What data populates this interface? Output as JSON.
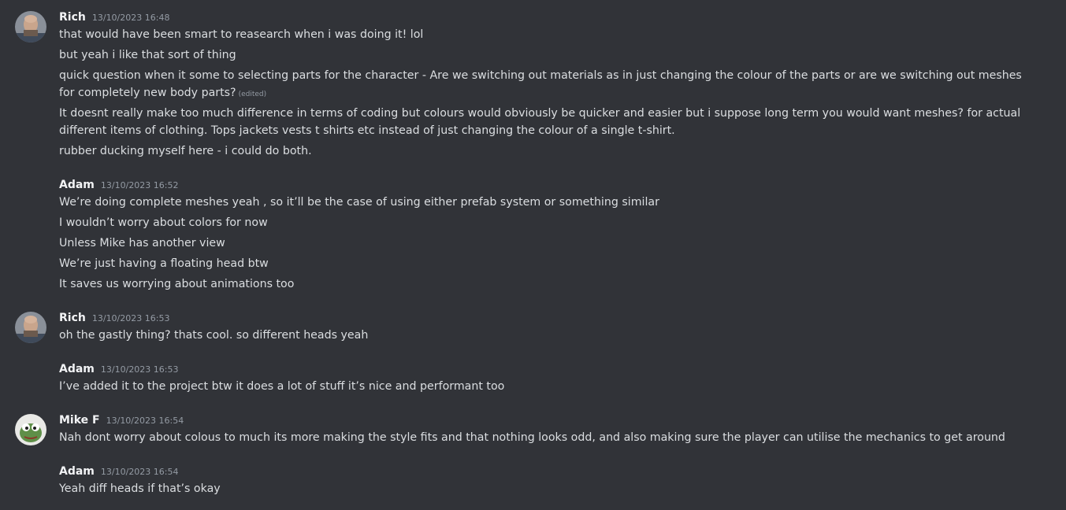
{
  "messages": [
    {
      "author": "Rich",
      "timestamp": "13/10/2023 16:48",
      "avatar": "bald-man-avatar-icon",
      "lines": [
        "that would have been smart to reasearch when i was doing it! lol",
        "but yeah i like that sort of thing",
        "quick question when it some to selecting parts for the character - Are we switching out materials as in just changing the colour of the parts or are we switching out meshes for completely new body parts?",
        "It doesnt really make too much difference in terms of coding but colours would obviously be quicker and easier but i suppose long term you would want meshes? for actual different items of clothing. Tops jackets vests t shirts etc instead of just changing the colour of a single t-shirt.",
        "rubber ducking myself here - i could do both."
      ],
      "edited_label": "(edited)"
    },
    {
      "author": "Adam",
      "timestamp": "13/10/2023 16:52",
      "lines": [
        "We’re doing complete meshes yeah , so it’ll be the case of using either prefab system or something similar",
        "I wouldn’t worry about colors for now",
        "Unless Mike has another view",
        "We’re just having a floating head btw",
        "It saves us worrying about animations too"
      ]
    },
    {
      "author": "Rich",
      "timestamp": "13/10/2023 16:53",
      "avatar": "bald-man-avatar-icon",
      "lines": [
        "oh the gastly thing? thats cool. so different heads yeah"
      ]
    },
    {
      "author": "Adam",
      "timestamp": "13/10/2023 16:53",
      "lines": [
        "I’ve added it to the project btw it does a lot of stuff it’s nice and performant too"
      ]
    },
    {
      "author": "Mike F",
      "timestamp": "13/10/2023 16:54",
      "avatar": "frog-avatar-icon",
      "lines": [
        "Nah dont worry about colous to much its more making the style fits and that nothing looks odd, and also making sure the player can utilise the mechanics to get around"
      ]
    },
    {
      "author": "Adam",
      "timestamp": "13/10/2023 16:54",
      "lines": [
        "Yeah diff heads if that’s okay"
      ]
    }
  ],
  "colors": {
    "background": "#313338",
    "author": "#f2f3f5",
    "text": "#dbdee1",
    "muted": "#949ba4"
  }
}
